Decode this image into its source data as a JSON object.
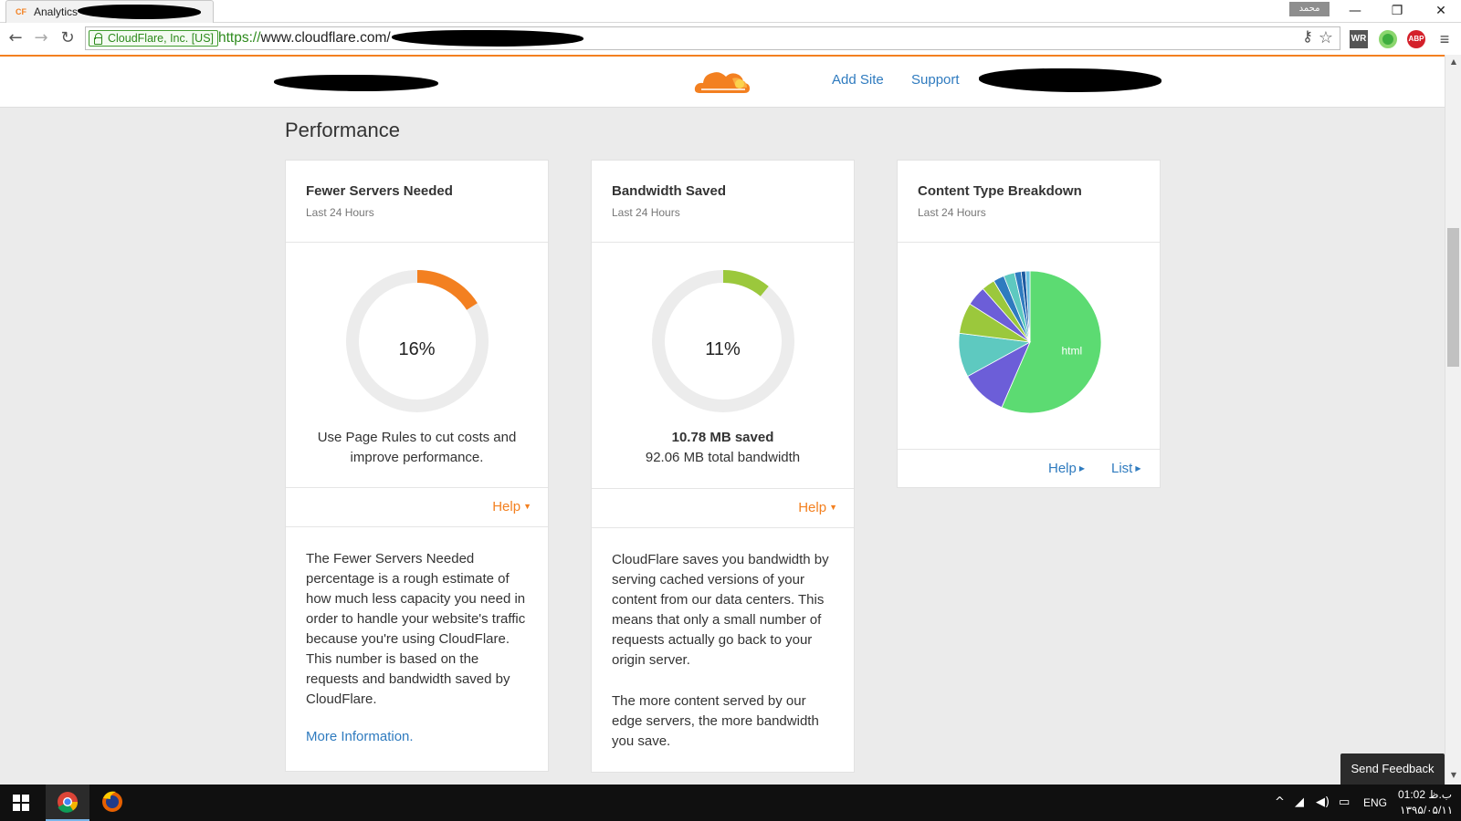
{
  "browser": {
    "tab_title": "Analytics",
    "tab_favicon": "CF",
    "user_badge": "محمد",
    "window_controls": {
      "minimize": "—",
      "restore": "❐",
      "close": "✕"
    },
    "nav": {
      "back": "←",
      "forward": "→",
      "reload": "↻"
    },
    "ev_badge": "CloudFlare, Inc. [US]",
    "url_scheme": "https://",
    "url_host": "www.cloudflare.com/",
    "extensions": [
      "key-icon",
      "star-icon",
      "wr-extension-icon",
      "refresh-extension-icon",
      "adblock-icon",
      "menu-icon"
    ],
    "ext_labels": {
      "wr": "WR",
      "abp": "ABP",
      "menu": "≡",
      "key": "⚷",
      "star": "☆"
    }
  },
  "site_header": {
    "add_site": "Add Site",
    "support": "Support"
  },
  "page": {
    "title": "Performance"
  },
  "cards": {
    "servers": {
      "title": "Fewer Servers Needed",
      "subtitle": "Last 24 Hours",
      "percent_value": 16,
      "percent": "16%",
      "color": "#f38020",
      "message_line1": "Use Page Rules to cut costs and",
      "message_line2": "improve performance.",
      "help": "Help",
      "description": "The Fewer Servers Needed percentage is a rough estimate of how much less capacity you need in order to handle your website's traffic because you're using CloudFlare. This number is based on the requests and bandwidth saved by CloudFlare.",
      "more_info": "More Information."
    },
    "bandwidth": {
      "title": "Bandwidth Saved",
      "subtitle": "Last 24 Hours",
      "percent_value": 11,
      "percent": "11%",
      "color": "#9bc83c",
      "saved": "10.78 MB saved",
      "total": "92.06 MB total bandwidth",
      "help": "Help",
      "description_p1": "CloudFlare saves you bandwidth by serving cached versions of your content from our data centers. This means that only a small number of requests actually go back to your origin server.",
      "description_p2": "The more content served by our edge servers, the more bandwidth you save."
    },
    "content_type": {
      "title": "Content Type Breakdown",
      "subtitle": "Last 24 Hours",
      "help": "Help",
      "list": "List"
    }
  },
  "chart_data": {
    "type": "pie",
    "slices": [
      {
        "label": "html",
        "value": 56.5,
        "color": "#5cdb72"
      },
      {
        "label": "",
        "value": 10.5,
        "color": "#6c5ed8"
      },
      {
        "label": "",
        "value": 10.0,
        "color": "#5ec9c0"
      },
      {
        "label": "",
        "value": 7.0,
        "color": "#9bc83c"
      },
      {
        "label": "",
        "value": 4.5,
        "color": "#6c5ed8"
      },
      {
        "label": "",
        "value": 3.0,
        "color": "#9bc83c"
      },
      {
        "label": "",
        "value": 2.5,
        "color": "#2f7bbf"
      },
      {
        "label": "",
        "value": 2.5,
        "color": "#5ec9c0"
      },
      {
        "label": "",
        "value": 1.5,
        "color": "#2f7bbf"
      },
      {
        "label": "",
        "value": 1.0,
        "color": "#1d5aa0"
      },
      {
        "label": "",
        "value": 1.0,
        "color": "#6cc2e0"
      }
    ]
  },
  "feedback": "Send Feedback",
  "taskbar": {
    "lang": "ENG",
    "time": "01:02 ب.ظ",
    "date": "۱۳۹۵/۰۵/۱۱",
    "apps": [
      "chrome-icon",
      "firefox-icon"
    ]
  }
}
